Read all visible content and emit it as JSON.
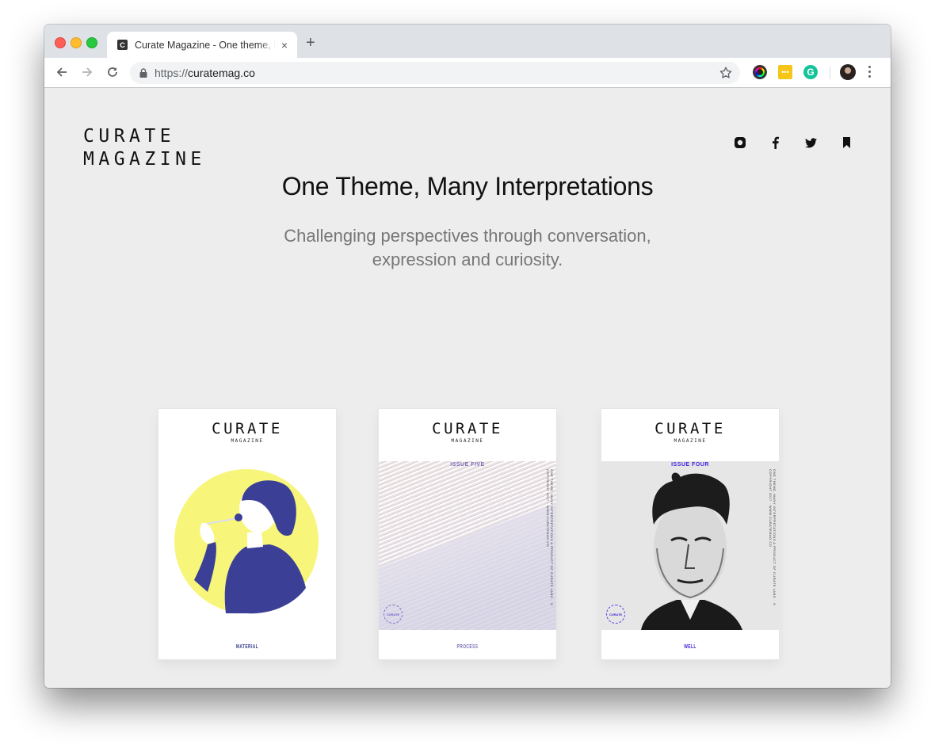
{
  "browser": {
    "tab_title": "Curate Magazine - One theme, Many Interpretations",
    "favicon_letter": "C",
    "tab_close": "×",
    "new_tab": "+",
    "url_scheme": "https://",
    "url_host": "curatemag.co",
    "extensions": [
      {
        "name": "color-picker-extension"
      },
      {
        "name": "yellow-extension",
        "glyph": "•••"
      },
      {
        "name": "grammarly-extension",
        "glyph": "G"
      }
    ]
  },
  "site": {
    "logo_line1": "CURATE",
    "logo_line2": "MAGAZINE",
    "social_links": [
      "instagram",
      "facebook",
      "twitter",
      "bookmark"
    ],
    "headline": "One Theme, Many Interpretations",
    "subhead_line1": "Challenging perspectives through conversation,",
    "subhead_line2": "expression and curiosity."
  },
  "covers": [
    {
      "masthead": "CURATE",
      "masthead_sub": "MAGAZINE",
      "issue": "",
      "title": "MATERIAL",
      "accent": "#3a3f8f",
      "art": "illustration-yellow-circle"
    },
    {
      "masthead": "CURATE",
      "masthead_sub": "MAGAZINE",
      "issue": "ISSUE FIVE",
      "title": "PROCESS",
      "accent": "#7a6fb8",
      "spine": "ONE THEME, MANY INTERPRETATIONS   A PRODUCT OF CURATE LABS · © COPYRIGHT 2017 · WWW.CURATEMAG.CO",
      "stamp": "CURATE",
      "art": "abstract-streaks"
    },
    {
      "masthead": "CURATE",
      "masthead_sub": "MAGAZINE",
      "issue": "ISSUE FOUR",
      "title": "WELL",
      "accent": "#3a1fe0",
      "spine": "ONE THEME, MANY INTERPRETATIONS   A PRODUCT OF CURATE LABS · © COPYRIGHT 2017 · WWW.CURATEMAG.CO",
      "stamp": "CURATE",
      "art": "charcoal-portrait"
    }
  ]
}
